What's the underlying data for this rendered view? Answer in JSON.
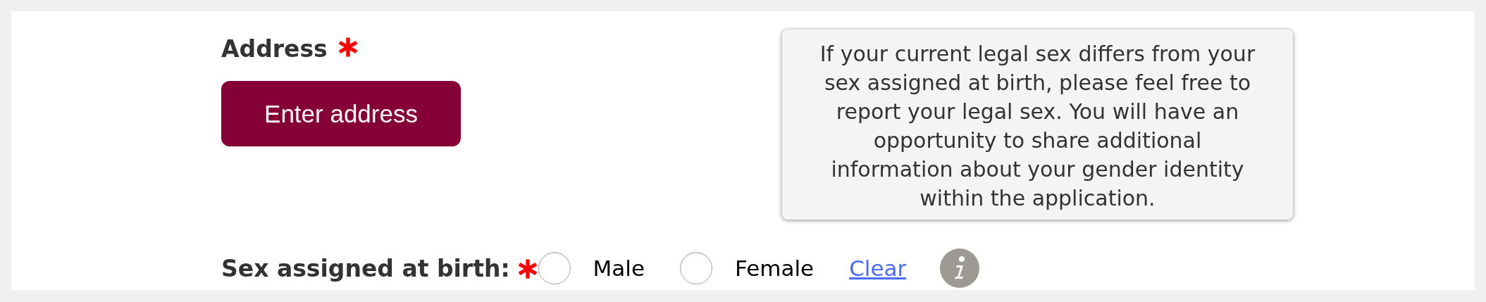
{
  "address": {
    "label": "Address",
    "required": true,
    "button": "Enter address"
  },
  "tooltip": {
    "text": "If your current legal sex differs from your sex assigned at birth, please feel free to report your legal sex. You will have an opportunity to share additional information about your gender identity within the application."
  },
  "sex_assigned_at_birth": {
    "label": "Sex assigned at birth:",
    "required": true,
    "options": [
      {
        "label": "Male",
        "selected": false
      },
      {
        "label": "Female",
        "selected": false
      }
    ],
    "clear_link": "Clear"
  }
}
